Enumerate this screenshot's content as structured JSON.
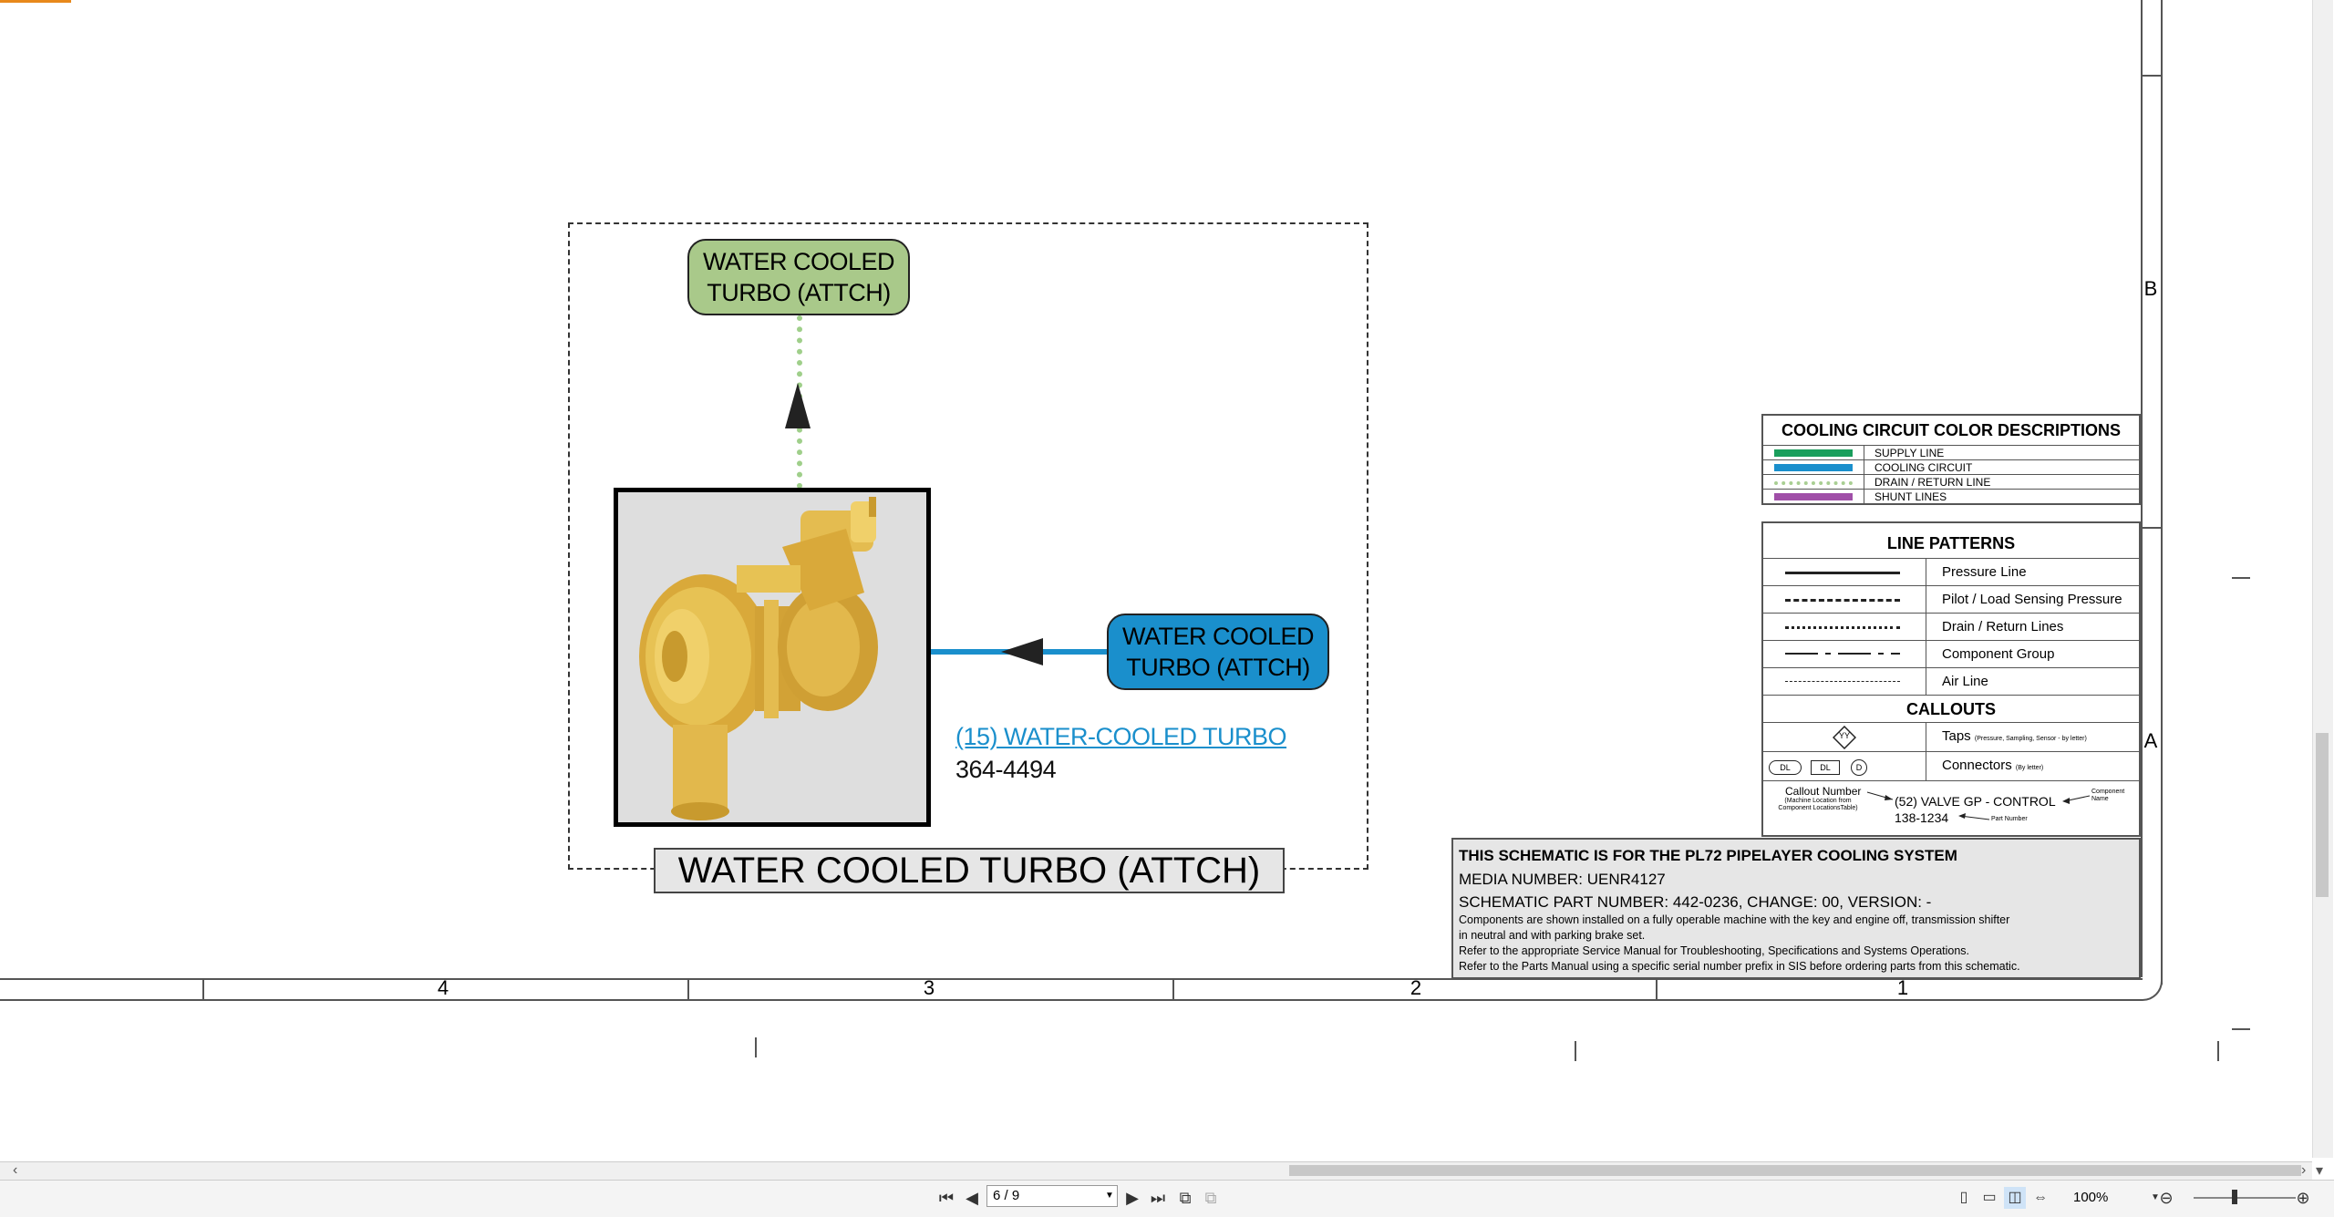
{
  "schematic": {
    "group_title": "WATER COOLED TURBO (ATTCH)",
    "callout_top": "WATER COOLED\nTURBO (ATTCH)",
    "callout_right": "WATER COOLED\nTURBO (ATTCH)",
    "component_link": "(15) WATER-COOLED TURBO",
    "component_part": "364-4494",
    "colors": {
      "drain": "#9fcf8a",
      "cooling": "#1a8fcc",
      "callout_green": "#a9c98a",
      "turbo_yellow": "#e7c254"
    }
  },
  "frame": {
    "zones": [
      "4",
      "3",
      "2",
      "1"
    ],
    "rows": [
      "B",
      "A"
    ]
  },
  "color_legend": {
    "title": "COOLING CIRCUIT COLOR DESCRIPTIONS",
    "items": [
      {
        "label": "SUPPLY LINE",
        "color": "#1a9e5c"
      },
      {
        "label": "COOLING CIRCUIT",
        "color": "#1a8fcc"
      },
      {
        "label": "DRAIN / RETURN LINE",
        "color": "#a9cf93"
      },
      {
        "label": "SHUNT LINES",
        "color": "#a04fa8"
      }
    ]
  },
  "line_patterns": {
    "title": "LINE PATTERNS",
    "items": [
      "Pressure Line",
      "Pilot / Load Sensing Pressure",
      "Drain / Return Lines",
      "Component Group",
      "Air Line"
    ],
    "callouts_title": "CALLOUTS",
    "taps_label": "Taps",
    "taps_note": "(Pressure, Sampling, Sensor - by letter)",
    "taps_symbol": "YY",
    "connectors_label": "Connectors",
    "connectors_note": "(By letter)",
    "connector_symbols": [
      "DL",
      "DL",
      "D"
    ],
    "example_callout_number": "Callout Number",
    "example_callout_note": "(Machine Location from Component LocationsTable)",
    "example_component": "(52) VALVE GP - CONTROL",
    "example_component_name": "Component Name",
    "example_part": "138-1234",
    "example_part_label": "Part Number"
  },
  "info": {
    "line1": "THIS SCHEMATIC IS FOR THE PL72 PIPELAYER COOLING SYSTEM",
    "line2": "MEDIA NUMBER: UENR4127",
    "line3": "SCHEMATIC PART NUMBER: 442-0236, CHANGE: 00, VERSION: -",
    "notes": [
      "Components are shown installed on a fully operable machine with the key and engine off, transmission shifter",
      "in neutral and with parking brake set.",
      "Refer to the appropriate Service Manual for Troubleshooting, Specifications and Systems Operations.",
      "Refer to the Parts Manual using a specific serial number prefix in SIS before ordering parts from this schematic."
    ]
  },
  "viewer": {
    "page_indicator": "6 / 9",
    "zoom": "100%"
  }
}
